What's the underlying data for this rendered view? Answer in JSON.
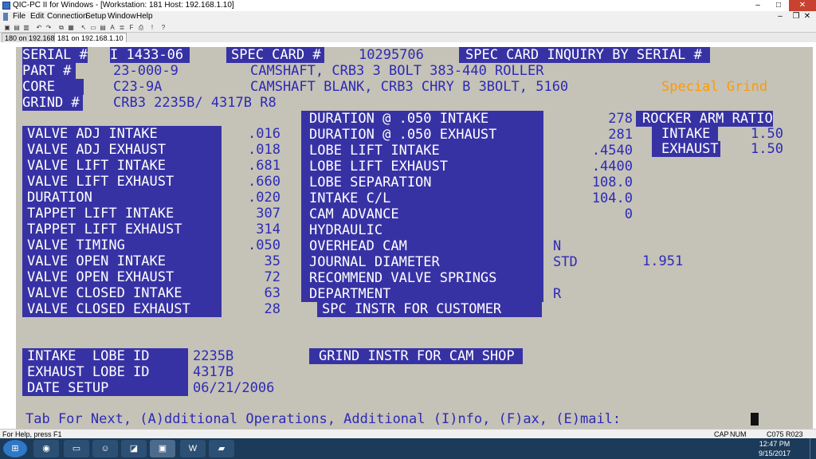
{
  "window": {
    "title": "QIC-PC II for Windows - [Workstation: 181  Host: 192.168.1.10]",
    "minimize": "–",
    "maximize": "□",
    "close": "✕"
  },
  "menu": [
    "File",
    "Edit",
    "Connection",
    "Setup",
    "Window",
    "Help"
  ],
  "tabs": [
    "180 on 192.168.1.10",
    "181 on 192.168.1.10"
  ],
  "screen": {
    "header": {
      "serial_label": "SERIAL #",
      "serial_value": "I 1433-06",
      "spec_card_label": "SPEC CARD #",
      "spec_card_value": "10295706",
      "screen_title": "SPEC CARD INQUIRY BY SERIAL #",
      "part_label": "PART #",
      "part_value": "23-000-9",
      "part_desc": "CAMSHAFT, CRB3 3 BOLT 383-440 ROLLER",
      "core_label": "CORE",
      "core_value": "C23-9A",
      "core_desc": "CAMSHAFT BLANK, CRB3 CHRY B 3BOLT, 5160",
      "special_note": "Special Grind",
      "grind_label": "GRIND #",
      "grind_value": "CRB3 2235B/ 4317B R8"
    },
    "left_fields": [
      {
        "label": "VALVE ADJ INTAKE",
        "value": ".016"
      },
      {
        "label": "VALVE ADJ EXHAUST",
        "value": ".018"
      },
      {
        "label": "VALVE LIFT INTAKE",
        "value": ".681"
      },
      {
        "label": "VALVE LIFT EXHAUST",
        "value": ".660"
      },
      {
        "label": "DURATION",
        "value": ".020"
      },
      {
        "label": "TAPPET LIFT INTAKE",
        "value": "307"
      },
      {
        "label": "TAPPET LIFT EXHAUST",
        "value": "314"
      },
      {
        "label": "VALVE TIMING",
        "value": ".050"
      },
      {
        "label": "VALVE OPEN INTAKE",
        "value": "35"
      },
      {
        "label": "VALVE OPEN EXHAUST",
        "value": "72"
      },
      {
        "label": "VALVE CLOSED INTAKE",
        "value": "63"
      },
      {
        "label": "VALVE CLOSED EXHAUST",
        "value": "28"
      }
    ],
    "mid_fields": [
      {
        "label": "DURATION @ .050 INTAKE",
        "value": "278"
      },
      {
        "label": "DURATION @ .050 EXHAUST",
        "value": "281"
      },
      {
        "label": "LOBE LIFT INTAKE",
        "value": ".4540"
      },
      {
        "label": "LOBE LIFT EXHAUST",
        "value": ".4400"
      },
      {
        "label": "LOBE SEPARATION",
        "value": "108.0"
      },
      {
        "label": "INTAKE C/L",
        "value": "104.0"
      },
      {
        "label": "CAM ADVANCE",
        "value": "0"
      },
      {
        "label": "HYDRAULIC",
        "value": ""
      },
      {
        "label": "OVERHEAD CAM",
        "value": "N"
      },
      {
        "label": "JOURNAL DIAMETER",
        "value": "STD"
      },
      {
        "label": "RECOMMEND VALVE SPRINGS",
        "value": ""
      },
      {
        "label": "DEPARTMENT",
        "value": "R"
      }
    ],
    "journal_diameter_extra": "1.951",
    "spc_instr": "SPC INSTR FOR CUSTOMER",
    "rocker": {
      "title": "ROCKER ARM RATIO",
      "intake_label": "INTAKE",
      "intake_value": "1.50",
      "exhaust_label": "EXHAUST",
      "exhaust_value": "1.50"
    },
    "lobe": {
      "intake_label": "INTAKE  LOBE ID",
      "intake_value": "2235B",
      "exhaust_label": "EXHAUST LOBE ID",
      "exhaust_value": "4317B",
      "date_label": "DATE SETUP",
      "date_value": "06/21/2006"
    },
    "grind_instr": "GRIND INSTR FOR CAM SHOP",
    "prompt": "Tab For Next, (A)dditional Operations, Additional (I)nfo, (F)ax, (E)mail:"
  },
  "status": {
    "help": "For Help, press F1",
    "caps": "CAP",
    "num": "NUM",
    "position": "C075  R023"
  },
  "taskbar": {
    "time": "12:47 PM",
    "date": "9/15/2017"
  },
  "colors": {
    "terminal_bg": "#c5c2b8",
    "field_bg": "#3732a4",
    "text_blue": "#2d2bb5",
    "accent_orange": "#ff9a00"
  }
}
